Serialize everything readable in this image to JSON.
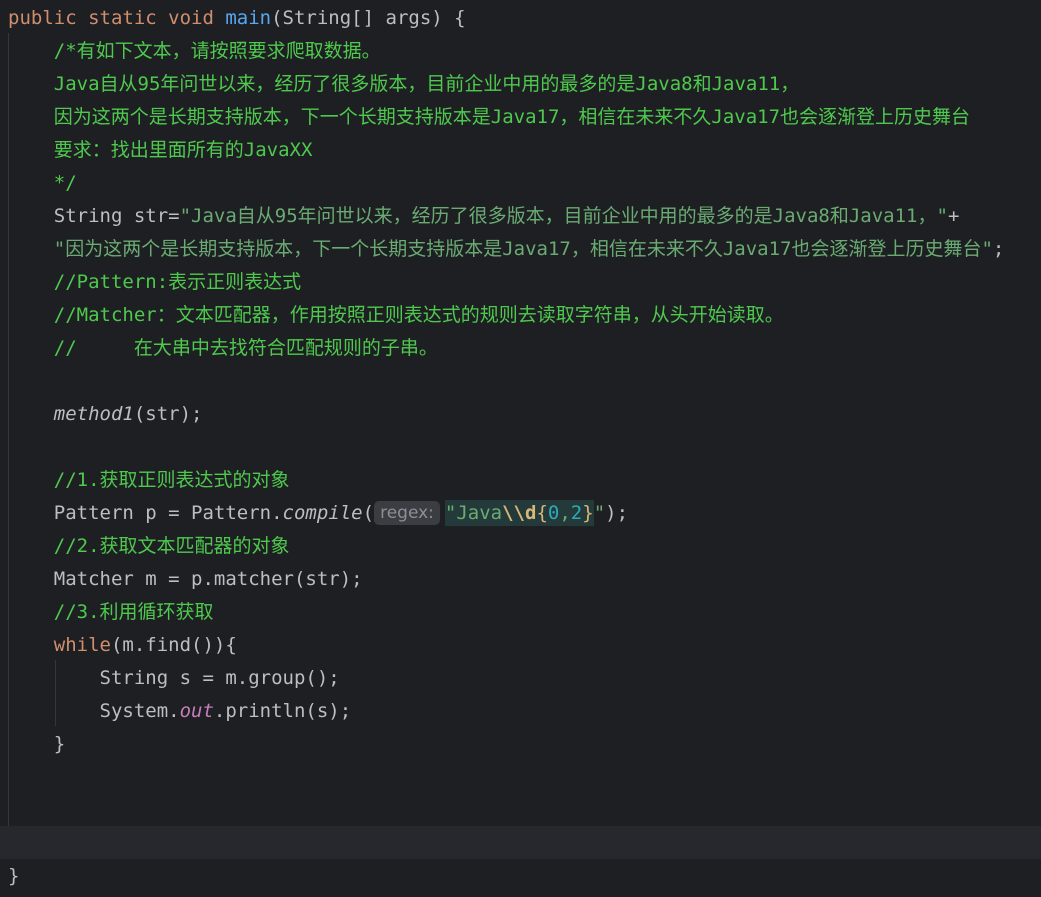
{
  "code_lines": [
    {
      "id": "l1",
      "segments": [
        {
          "cls": "kw",
          "text": "public static void "
        },
        {
          "cls": "fn",
          "text": "main"
        },
        {
          "cls": "",
          "text": "(String[] args) {"
        }
      ]
    },
    {
      "id": "l2",
      "segments": [
        {
          "cls": "cm",
          "text": "    /*有如下文本，请按照要求爬取数据。"
        }
      ]
    },
    {
      "id": "l3",
      "segments": [
        {
          "cls": "cm",
          "text": "    Java自从95年问世以来，经历了很多版本，目前企业中用的最多的是Java8和Java11，"
        }
      ]
    },
    {
      "id": "l4",
      "segments": [
        {
          "cls": "cm",
          "text": "    因为这两个是长期支持版本，下一个长期支持版本是Java17，相信在未来不久Java17也会逐渐登上历史舞台"
        }
      ]
    },
    {
      "id": "l5",
      "segments": [
        {
          "cls": "cm",
          "text": "    要求：找出里面所有的JavaXX"
        }
      ]
    },
    {
      "id": "l6",
      "segments": [
        {
          "cls": "cm",
          "text": "    */"
        }
      ]
    },
    {
      "id": "l7",
      "segments": [
        {
          "cls": "",
          "text": "    String str="
        },
        {
          "cls": "str",
          "text": "\"Java自从95年问世以来，经历了很多版本，目前企业中用的最多的是Java8和Java11，\""
        },
        {
          "cls": "",
          "text": "+"
        }
      ]
    },
    {
      "id": "l8",
      "segments": [
        {
          "cls": "str",
          "text": "    \"因为这两个是长期支持版本，下一个长期支持版本是Java17，相信在未来不久Java17也会逐渐登上历史舞台\""
        },
        {
          "cls": "",
          "text": ";"
        }
      ]
    },
    {
      "id": "l9",
      "segments": [
        {
          "cls": "cm",
          "text": "    //Pattern:表示正则表达式"
        }
      ]
    },
    {
      "id": "l10",
      "segments": [
        {
          "cls": "cm",
          "text": "    //Matcher：文本匹配器，作用按照正则表达式的规则去读取字符串，从头开始读取。"
        }
      ]
    },
    {
      "id": "l11",
      "segments": [
        {
          "cls": "cm",
          "text": "    //     在大串中去找符合匹配规则的子串。"
        }
      ]
    },
    {
      "id": "l12",
      "segments": []
    },
    {
      "id": "l13",
      "segments": [
        {
          "cls": "",
          "text": "    "
        },
        {
          "cls": "it",
          "text": "method1"
        },
        {
          "cls": "",
          "text": "(str);"
        }
      ]
    },
    {
      "id": "l14",
      "segments": []
    },
    {
      "id": "l15",
      "segments": [
        {
          "cls": "cm",
          "text": "    //1.获取正则表达式的对象"
        }
      ]
    },
    {
      "id": "l16",
      "segments": [
        {
          "cls": "",
          "text": "    Pattern p = Pattern."
        },
        {
          "cls": "it",
          "text": "compile"
        },
        {
          "cls": "",
          "text": "("
        },
        {
          "cls": "hint",
          "text": "regex:"
        },
        {
          "cls": "rx",
          "parts": [
            {
              "cls": "rx-lit",
              "text": "\"Java"
            },
            {
              "cls": "rx-esc",
              "text": "\\\\d"
            },
            {
              "cls": "rx-br",
              "text": "{"
            },
            {
              "cls": "rx-num",
              "text": "0"
            },
            {
              "cls": "rx-lit",
              "text": ","
            },
            {
              "cls": "rx-num",
              "text": "2"
            },
            {
              "cls": "rx-br",
              "text": "}"
            }
          ]
        },
        {
          "cls": "str",
          "text": "\""
        },
        {
          "cls": "",
          "text": ");"
        }
      ]
    },
    {
      "id": "l17",
      "segments": [
        {
          "cls": "cm",
          "text": "    //2.获取文本匹配器的对象"
        }
      ]
    },
    {
      "id": "l18",
      "segments": [
        {
          "cls": "",
          "text": "    Matcher m = p.matcher(str);"
        }
      ]
    },
    {
      "id": "l19",
      "segments": [
        {
          "cls": "cm",
          "text": "    //3.利用循环获取"
        }
      ]
    },
    {
      "id": "l20",
      "segments": [
        {
          "cls": "kw",
          "text": "    while"
        },
        {
          "cls": "",
          "text": "(m.find()){"
        }
      ]
    },
    {
      "id": "l21",
      "segments": [
        {
          "cls": "",
          "text": "        String s = m.group();"
        }
      ]
    },
    {
      "id": "l22",
      "segments": [
        {
          "cls": "",
          "text": "        System."
        },
        {
          "cls": "field",
          "text": "out"
        },
        {
          "cls": "",
          "text": ".println(s);"
        }
      ]
    },
    {
      "id": "l23",
      "segments": [
        {
          "cls": "",
          "text": "    }"
        }
      ]
    },
    {
      "id": "l24",
      "segments": []
    },
    {
      "id": "l25",
      "segments": []
    },
    {
      "id": "l26",
      "segments": []
    },
    {
      "id": "l27",
      "segments": [
        {
          "cls": "",
          "text": "}"
        }
      ]
    }
  ]
}
